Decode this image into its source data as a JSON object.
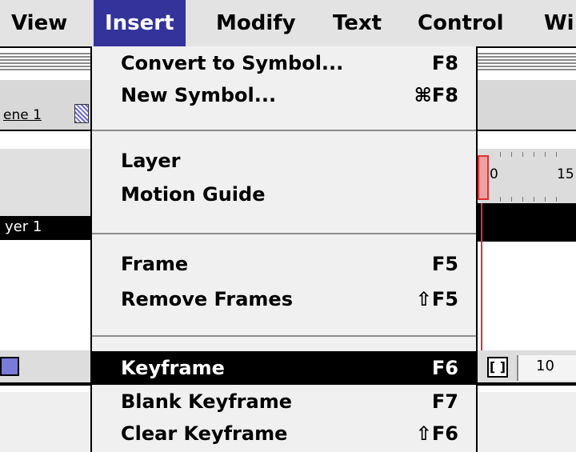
{
  "menubar": {
    "items": [
      {
        "label": "View",
        "active": false
      },
      {
        "label": "Insert",
        "active": true
      },
      {
        "label": "Modify",
        "active": false
      },
      {
        "label": "Text",
        "active": false
      },
      {
        "label": "Control",
        "active": false
      },
      {
        "label": "Wi",
        "active": false
      }
    ]
  },
  "background": {
    "scene_tab": "ene 1",
    "layer_name": "yer 1",
    "ruler_labels": [
      "0",
      "15"
    ],
    "frame_field": "10",
    "accent_colors": {
      "playhead": "#e03030",
      "menu_highlight": "#33339b"
    }
  },
  "dropdown": {
    "groups": [
      [
        {
          "label": "Convert to Symbol...",
          "shortcut": "F8"
        },
        {
          "label": "New Symbol...",
          "shortcut": "⌘F8"
        }
      ],
      [
        {
          "label": "Layer",
          "shortcut": ""
        },
        {
          "label": "Motion Guide",
          "shortcut": ""
        }
      ],
      [
        {
          "label": "Frame",
          "shortcut": "F5"
        },
        {
          "label": "Remove Frames",
          "shortcut": "⇧F5"
        }
      ],
      [
        {
          "label": "Keyframe",
          "shortcut": "F6",
          "highlighted": true
        },
        {
          "label": "Blank Keyframe",
          "shortcut": "F7"
        },
        {
          "label": "Clear Keyframe",
          "shortcut": "⇧F6"
        }
      ]
    ]
  }
}
